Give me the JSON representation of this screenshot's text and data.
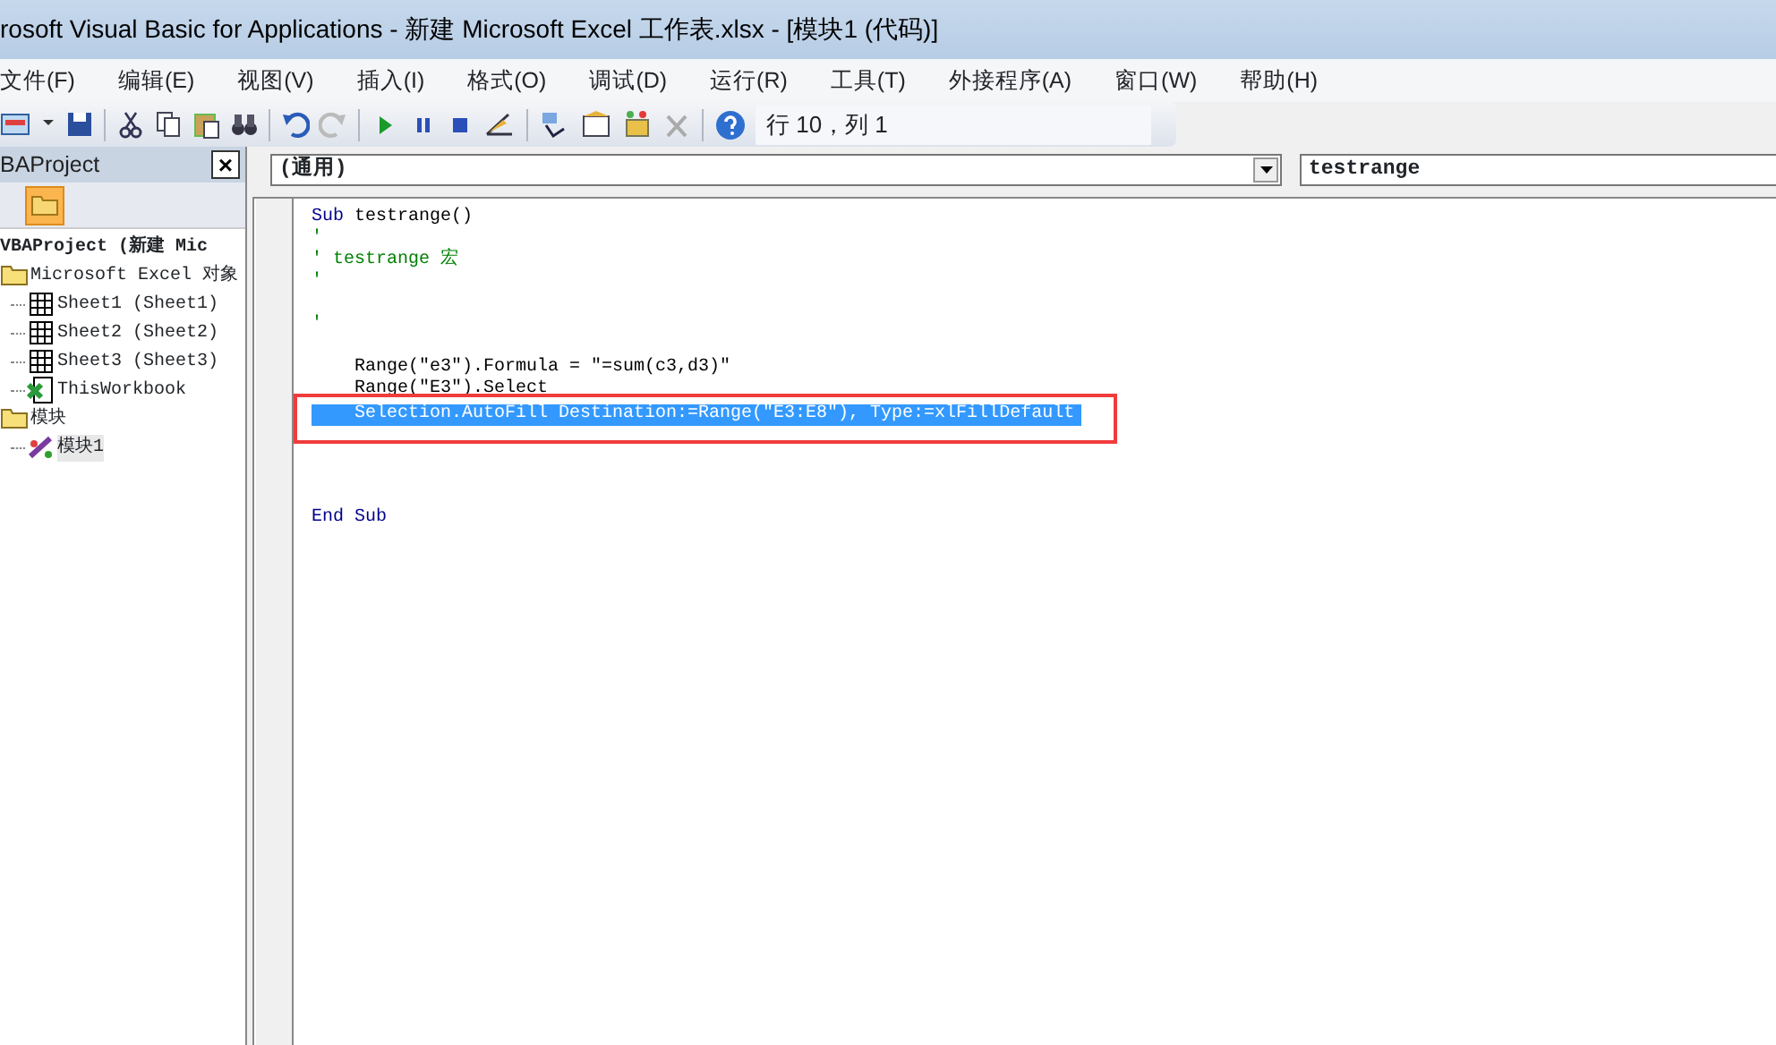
{
  "window": {
    "title": "rosoft Visual Basic for Applications - 新建 Microsoft Excel 工作表.xlsx - [模块1 (代码)]"
  },
  "menu": [
    "文件(F)",
    "编辑(E)",
    "视图(V)",
    "插入(I)",
    "格式(O)",
    "调试(D)",
    "运行(R)",
    "工具(T)",
    "外接程序(A)",
    "窗口(W)",
    "帮助(H)"
  ],
  "toolbar": {
    "position": "行 10，列 1"
  },
  "project_panel": {
    "title": "BAProject",
    "close": "×",
    "tree": [
      {
        "label": "VBAProject (新建 Mic",
        "kind": "project",
        "selected": false,
        "children": [
          {
            "label": "Microsoft Excel 对象",
            "kind": "folder",
            "selected": false,
            "children": [
              {
                "label": "Sheet1 (Sheet1)",
                "kind": "sheet",
                "selected": false
              },
              {
                "label": "Sheet2 (Sheet2)",
                "kind": "sheet",
                "selected": false
              },
              {
                "label": "Sheet3 (Sheet3)",
                "kind": "sheet",
                "selected": false
              },
              {
                "label": "ThisWorkbook",
                "kind": "workbook",
                "selected": false
              }
            ]
          },
          {
            "label": "模块",
            "kind": "folder",
            "selected": false,
            "children": [
              {
                "label": "模块1",
                "kind": "module",
                "selected": true
              }
            ]
          }
        ]
      }
    ]
  },
  "code_window": {
    "object_combo": "(通用)",
    "procedure_combo": "testrange",
    "lines": [
      {
        "selected": false,
        "segments": [
          {
            "kind": "keyword",
            "text": "Sub"
          },
          {
            "kind": "plain",
            "text": " testrange()"
          }
        ]
      },
      {
        "selected": false,
        "segments": [
          {
            "kind": "comment",
            "text": "'"
          }
        ]
      },
      {
        "selected": false,
        "segments": [
          {
            "kind": "comment",
            "text": "' testrange 宏"
          }
        ]
      },
      {
        "selected": false,
        "segments": [
          {
            "kind": "comment",
            "text": "'"
          }
        ]
      },
      {
        "selected": false
      },
      {
        "selected": false,
        "segments": [
          {
            "kind": "comment",
            "text": "'"
          }
        ]
      },
      {
        "selected": false
      },
      {
        "selected": false,
        "segments": [
          {
            "kind": "plain",
            "text": "    Range(\"e3\").Formula = \"=sum(c3,d3)\""
          }
        ]
      },
      {
        "selected": false,
        "segments": [
          {
            "kind": "plain",
            "text": "    Range(\"E3\").Select"
          }
        ]
      },
      {
        "selected": true,
        "highlighted": true,
        "segments": [
          {
            "kind": "plain",
            "text": "    Selection.AutoFill Destination:=Range(\"E3:E8\"), Type:=xlFillDefault"
          }
        ]
      },
      {
        "selected": false
      },
      {
        "selected": false
      },
      {
        "selected": false
      },
      {
        "selected": false
      },
      {
        "selected": false,
        "segments": [
          {
            "kind": "keyword",
            "text": "End Sub"
          }
        ]
      }
    ]
  }
}
